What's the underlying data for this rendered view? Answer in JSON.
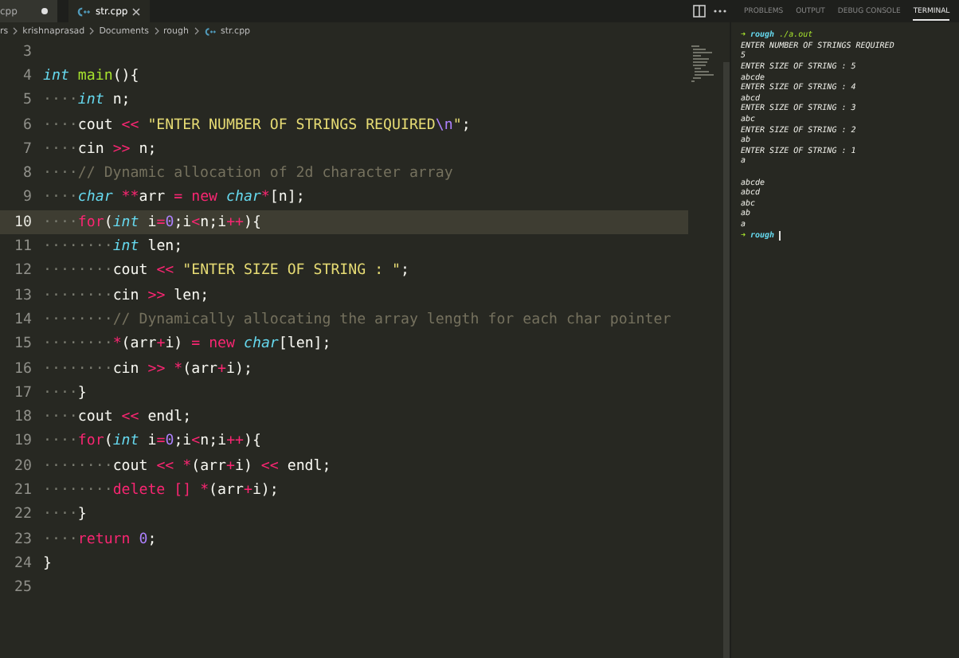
{
  "tabs": [
    {
      "label": "cpp",
      "selected": false,
      "modified": true
    },
    {
      "label": "str.cpp",
      "selected": true,
      "modified": false
    }
  ],
  "breadcrumb": [
    "rs",
    "krishnaprasad",
    "Documents",
    "rough",
    "str.cpp"
  ],
  "code_lines": [
    {
      "number": "3",
      "current": false
    },
    {
      "number": "4",
      "current": false,
      "tokens": [
        {
          "text": "int ",
          "kind": "type"
        },
        {
          "text": "main",
          "kind": "fn"
        },
        {
          "text": "(){",
          "kind": "p"
        }
      ]
    },
    {
      "number": "5",
      "current": false,
      "tokens": [
        {
          "text": "····",
          "kind": "ws"
        },
        {
          "text": "int",
          "kind": "type"
        },
        {
          "text": " n;",
          "kind": "p"
        }
      ]
    },
    {
      "number": "6",
      "current": false,
      "tokens": [
        {
          "text": "····",
          "kind": "ws"
        },
        {
          "text": "cout ",
          "kind": "p"
        },
        {
          "text": "<<",
          "kind": "op"
        },
        {
          "text": " \"ENTER NUMBER OF STRINGS REQUIRED",
          "kind": "str"
        },
        {
          "text": "\\n",
          "kind": "esc"
        },
        {
          "text": "\"",
          "kind": "str"
        },
        {
          "text": ";",
          "kind": "p"
        }
      ]
    },
    {
      "number": "7",
      "current": false,
      "tokens": [
        {
          "text": "····",
          "kind": "ws"
        },
        {
          "text": "cin ",
          "kind": "p"
        },
        {
          "text": ">>",
          "kind": "op"
        },
        {
          "text": " n;",
          "kind": "p"
        }
      ]
    },
    {
      "number": "8",
      "current": false,
      "tokens": [
        {
          "text": "····",
          "kind": "ws"
        },
        {
          "text": "// Dynamic allocation of 2d character array",
          "kind": "cmt"
        }
      ]
    },
    {
      "number": "9",
      "current": false,
      "tokens": [
        {
          "text": "····",
          "kind": "ws"
        },
        {
          "text": "char ",
          "kind": "type"
        },
        {
          "text": "**",
          "kind": "op"
        },
        {
          "text": "arr ",
          "kind": "p"
        },
        {
          "text": "=",
          "kind": "op"
        },
        {
          "text": " new",
          "kind": "kw"
        },
        {
          "text": " char",
          "kind": "type"
        },
        {
          "text": "*",
          "kind": "op"
        },
        {
          "text": "[n];",
          "kind": "p"
        }
      ]
    },
    {
      "number": "10",
      "current": true,
      "tokens": [
        {
          "text": "····",
          "kind": "ws"
        },
        {
          "text": "for",
          "kind": "kw"
        },
        {
          "text": "(",
          "kind": "p"
        },
        {
          "text": "int",
          "kind": "type"
        },
        {
          "text": " i",
          "kind": "p"
        },
        {
          "text": "=",
          "kind": "op"
        },
        {
          "text": "0",
          "kind": "num"
        },
        {
          "text": ";i",
          "kind": "p"
        },
        {
          "text": "<",
          "kind": "op"
        },
        {
          "text": "n;i",
          "kind": "p"
        },
        {
          "text": "++",
          "kind": "op"
        },
        {
          "text": "){",
          "kind": "p"
        }
      ]
    },
    {
      "number": "11",
      "current": false,
      "tokens": [
        {
          "text": "········",
          "kind": "ws"
        },
        {
          "text": "int",
          "kind": "type"
        },
        {
          "text": " len;",
          "kind": "p"
        }
      ]
    },
    {
      "number": "12",
      "current": false,
      "tokens": [
        {
          "text": "········",
          "kind": "ws"
        },
        {
          "text": "cout ",
          "kind": "p"
        },
        {
          "text": "<<",
          "kind": "op"
        },
        {
          "text": " \"ENTER SIZE OF STRING : \"",
          "kind": "str"
        },
        {
          "text": ";",
          "kind": "p"
        }
      ]
    },
    {
      "number": "13",
      "current": false,
      "tokens": [
        {
          "text": "········",
          "kind": "ws"
        },
        {
          "text": "cin ",
          "kind": "p"
        },
        {
          "text": ">>",
          "kind": "op"
        },
        {
          "text": " len;",
          "kind": "p"
        }
      ]
    },
    {
      "number": "14",
      "current": false,
      "tokens": [
        {
          "text": "········",
          "kind": "ws"
        },
        {
          "text": "// Dynamically allocating the array length for each char pointer",
          "kind": "cmt"
        }
      ]
    },
    {
      "number": "15",
      "current": false,
      "tokens": [
        {
          "text": "········",
          "kind": "ws"
        },
        {
          "text": "*",
          "kind": "op"
        },
        {
          "text": "(arr",
          "kind": "p"
        },
        {
          "text": "+",
          "kind": "op"
        },
        {
          "text": "i) ",
          "kind": "p"
        },
        {
          "text": "=",
          "kind": "op"
        },
        {
          "text": " new",
          "kind": "kw"
        },
        {
          "text": " char",
          "kind": "type"
        },
        {
          "text": "[len];",
          "kind": "p"
        }
      ]
    },
    {
      "number": "16",
      "current": false,
      "tokens": [
        {
          "text": "········",
          "kind": "ws"
        },
        {
          "text": "cin ",
          "kind": "p"
        },
        {
          "text": ">>",
          "kind": "op"
        },
        {
          "text": " *",
          "kind": "op"
        },
        {
          "text": "(arr",
          "kind": "p"
        },
        {
          "text": "+",
          "kind": "op"
        },
        {
          "text": "i);",
          "kind": "p"
        }
      ]
    },
    {
      "number": "17",
      "current": false,
      "tokens": [
        {
          "text": "····",
          "kind": "ws"
        },
        {
          "text": "}",
          "kind": "p"
        }
      ]
    },
    {
      "number": "18",
      "current": false,
      "tokens": [
        {
          "text": "····",
          "kind": "ws"
        },
        {
          "text": "cout ",
          "kind": "p"
        },
        {
          "text": "<<",
          "kind": "op"
        },
        {
          "text": " endl;",
          "kind": "p"
        }
      ]
    },
    {
      "number": "19",
      "current": false,
      "tokens": [
        {
          "text": "····",
          "kind": "ws"
        },
        {
          "text": "for",
          "kind": "kw"
        },
        {
          "text": "(",
          "kind": "p"
        },
        {
          "text": "int",
          "kind": "type"
        },
        {
          "text": " i",
          "kind": "p"
        },
        {
          "text": "=",
          "kind": "op"
        },
        {
          "text": "0",
          "kind": "num"
        },
        {
          "text": ";i",
          "kind": "p"
        },
        {
          "text": "<",
          "kind": "op"
        },
        {
          "text": "n;i",
          "kind": "p"
        },
        {
          "text": "++",
          "kind": "op"
        },
        {
          "text": "){",
          "kind": "p"
        }
      ]
    },
    {
      "number": "20",
      "current": false,
      "tokens": [
        {
          "text": "········",
          "kind": "ws"
        },
        {
          "text": "cout ",
          "kind": "p"
        },
        {
          "text": "<<",
          "kind": "op"
        },
        {
          "text": " *",
          "kind": "op"
        },
        {
          "text": "(arr",
          "kind": "p"
        },
        {
          "text": "+",
          "kind": "op"
        },
        {
          "text": "i) ",
          "kind": "p"
        },
        {
          "text": "<<",
          "kind": "op"
        },
        {
          "text": " endl;",
          "kind": "p"
        }
      ]
    },
    {
      "number": "21",
      "current": false,
      "tokens": [
        {
          "text": "········",
          "kind": "ws"
        },
        {
          "text": "delete ",
          "kind": "kw"
        },
        {
          "text": "[] *",
          "kind": "op"
        },
        {
          "text": "(arr",
          "kind": "p"
        },
        {
          "text": "+",
          "kind": "op"
        },
        {
          "text": "i);",
          "kind": "p"
        }
      ]
    },
    {
      "number": "22",
      "current": false,
      "tokens": [
        {
          "text": "····",
          "kind": "ws"
        },
        {
          "text": "}",
          "kind": "p"
        }
      ]
    },
    {
      "number": "23",
      "current": false,
      "tokens": [
        {
          "text": "····",
          "kind": "ws"
        },
        {
          "text": "return ",
          "kind": "kw"
        },
        {
          "text": "0",
          "kind": "num"
        },
        {
          "text": ";",
          "kind": "p"
        }
      ]
    },
    {
      "number": "24",
      "current": false,
      "tokens": [
        {
          "text": "}",
          "kind": "p"
        }
      ]
    },
    {
      "number": "25",
      "current": false
    }
  ],
  "panel_tabs": [
    {
      "label": "PROBLEMS",
      "selected": false
    },
    {
      "label": "OUTPUT",
      "selected": false
    },
    {
      "label": "DEBUG CONSOLE",
      "selected": false
    },
    {
      "label": "TERMINAL",
      "selected": true
    }
  ],
  "terminal_lines": [
    {
      "kind": "prompt",
      "symbol": "➜",
      "dir": "rough",
      "command": "./a.out",
      "cursor": false
    },
    {
      "kind": "output",
      "text": "ENTER NUMBER OF STRINGS REQUIRED"
    },
    {
      "kind": "output",
      "text": "5"
    },
    {
      "kind": "output",
      "text": "ENTER SIZE OF STRING : 5"
    },
    {
      "kind": "output",
      "text": "abcde"
    },
    {
      "kind": "output",
      "text": "ENTER SIZE OF STRING : 4"
    },
    {
      "kind": "output",
      "text": "abcd"
    },
    {
      "kind": "output",
      "text": "ENTER SIZE OF STRING : 3"
    },
    {
      "kind": "output",
      "text": "abc"
    },
    {
      "kind": "output",
      "text": "ENTER SIZE OF STRING : 2"
    },
    {
      "kind": "output",
      "text": "ab"
    },
    {
      "kind": "output",
      "text": "ENTER SIZE OF STRING : 1"
    },
    {
      "kind": "output",
      "text": "a"
    },
    {
      "kind": "blank"
    },
    {
      "kind": "output",
      "text": "abcde"
    },
    {
      "kind": "output",
      "text": "abcd"
    },
    {
      "kind": "output",
      "text": "abc"
    },
    {
      "kind": "output",
      "text": "ab"
    },
    {
      "kind": "output",
      "text": "a"
    },
    {
      "kind": "prompt",
      "symbol": "➜",
      "dir": "rough",
      "cursor": true
    }
  ]
}
